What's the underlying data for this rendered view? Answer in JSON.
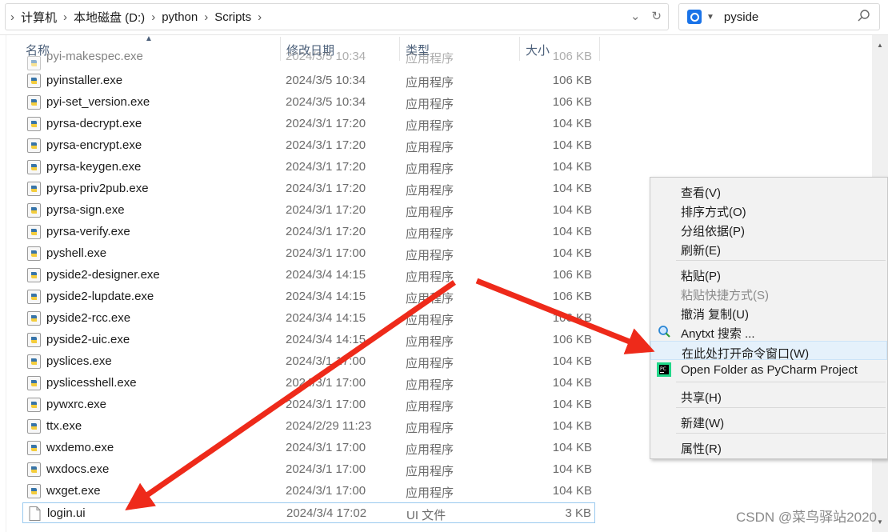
{
  "address": {
    "crumbs": [
      "计算机",
      "本地磁盘 (D:)",
      "python",
      "Scripts"
    ],
    "dropdown_glyph": "⌄",
    "refresh_glyph": "↻"
  },
  "search": {
    "value": "pyside"
  },
  "columns": {
    "name": "名称",
    "date": "修改日期",
    "type": "类型",
    "size": "大小"
  },
  "files": [
    {
      "name": "pyi-makespec.exe",
      "date": "2024/3/5 10:34",
      "type": "应用程序",
      "size": "106 KB",
      "icon": "python-exe-icon"
    },
    {
      "name": "pyinstaller.exe",
      "date": "2024/3/5 10:34",
      "type": "应用程序",
      "size": "106 KB",
      "icon": "python-exe-icon"
    },
    {
      "name": "pyi-set_version.exe",
      "date": "2024/3/5 10:34",
      "type": "应用程序",
      "size": "106 KB",
      "icon": "python-exe-icon"
    },
    {
      "name": "pyrsa-decrypt.exe",
      "date": "2024/3/1 17:20",
      "type": "应用程序",
      "size": "104 KB",
      "icon": "python-exe-icon"
    },
    {
      "name": "pyrsa-encrypt.exe",
      "date": "2024/3/1 17:20",
      "type": "应用程序",
      "size": "104 KB",
      "icon": "python-exe-icon"
    },
    {
      "name": "pyrsa-keygen.exe",
      "date": "2024/3/1 17:20",
      "type": "应用程序",
      "size": "104 KB",
      "icon": "python-exe-icon"
    },
    {
      "name": "pyrsa-priv2pub.exe",
      "date": "2024/3/1 17:20",
      "type": "应用程序",
      "size": "104 KB",
      "icon": "python-exe-icon"
    },
    {
      "name": "pyrsa-sign.exe",
      "date": "2024/3/1 17:20",
      "type": "应用程序",
      "size": "104 KB",
      "icon": "python-exe-icon"
    },
    {
      "name": "pyrsa-verify.exe",
      "date": "2024/3/1 17:20",
      "type": "应用程序",
      "size": "104 KB",
      "icon": "python-exe-icon"
    },
    {
      "name": "pyshell.exe",
      "date": "2024/3/1 17:00",
      "type": "应用程序",
      "size": "104 KB",
      "icon": "python-exe-icon"
    },
    {
      "name": "pyside2-designer.exe",
      "date": "2024/3/4 14:15",
      "type": "应用程序",
      "size": "106 KB",
      "icon": "python-exe-icon"
    },
    {
      "name": "pyside2-lupdate.exe",
      "date": "2024/3/4 14:15",
      "type": "应用程序",
      "size": "106 KB",
      "icon": "python-exe-icon"
    },
    {
      "name": "pyside2-rcc.exe",
      "date": "2024/3/4 14:15",
      "type": "应用程序",
      "size": "106 KB",
      "icon": "python-exe-icon"
    },
    {
      "name": "pyside2-uic.exe",
      "date": "2024/3/4 14:15",
      "type": "应用程序",
      "size": "106 KB",
      "icon": "python-exe-icon"
    },
    {
      "name": "pyslices.exe",
      "date": "2024/3/1 17:00",
      "type": "应用程序",
      "size": "104 KB",
      "icon": "python-exe-icon"
    },
    {
      "name": "pyslicesshell.exe",
      "date": "2024/3/1 17:00",
      "type": "应用程序",
      "size": "104 KB",
      "icon": "python-exe-icon"
    },
    {
      "name": "pywxrc.exe",
      "date": "2024/3/1 17:00",
      "type": "应用程序",
      "size": "104 KB",
      "icon": "python-exe-icon"
    },
    {
      "name": "ttx.exe",
      "date": "2024/2/29 11:23",
      "type": "应用程序",
      "size": "104 KB",
      "icon": "python-exe-icon"
    },
    {
      "name": "wxdemo.exe",
      "date": "2024/3/1 17:00",
      "type": "应用程序",
      "size": "104 KB",
      "icon": "python-exe-icon"
    },
    {
      "name": "wxdocs.exe",
      "date": "2024/3/1 17:00",
      "type": "应用程序",
      "size": "104 KB",
      "icon": "python-exe-icon"
    },
    {
      "name": "wxget.exe",
      "date": "2024/3/1 17:00",
      "type": "应用程序",
      "size": "104 KB",
      "icon": "python-exe-icon"
    },
    {
      "name": "login.ui",
      "date": "2024/3/4 17:02",
      "type": "UI 文件",
      "size": "3 KB",
      "icon": "blank-file-icon"
    }
  ],
  "context_menu": [
    {
      "label": "查看(V)"
    },
    {
      "label": "排序方式(O)"
    },
    {
      "label": "分组依据(P)"
    },
    {
      "label": "刷新(E)"
    },
    {
      "separator": true
    },
    {
      "label": "粘贴(P)"
    },
    {
      "label": "粘贴快捷方式(S)",
      "disabled": true
    },
    {
      "label": "撤消 复制(U)"
    },
    {
      "label": "Anytxt 搜索 ...",
      "icon": "anytxt-search-icon"
    },
    {
      "label": "在此处打开命令窗口(W)",
      "highlighted": true
    },
    {
      "label": "Open Folder as PyCharm Project",
      "icon": "pycharm-icon"
    },
    {
      "separator": true
    },
    {
      "label": "共享(H)"
    },
    {
      "separator": true
    },
    {
      "label": "新建(W)"
    },
    {
      "separator": true
    },
    {
      "label": "属性(R)"
    }
  ],
  "watermark": "CSDN @菜鸟驿站2020",
  "colors": {
    "annotation_arrow": "#ee2a1a",
    "menu_highlight": "#e5f1fb",
    "selection_border": "#99c9ef"
  }
}
